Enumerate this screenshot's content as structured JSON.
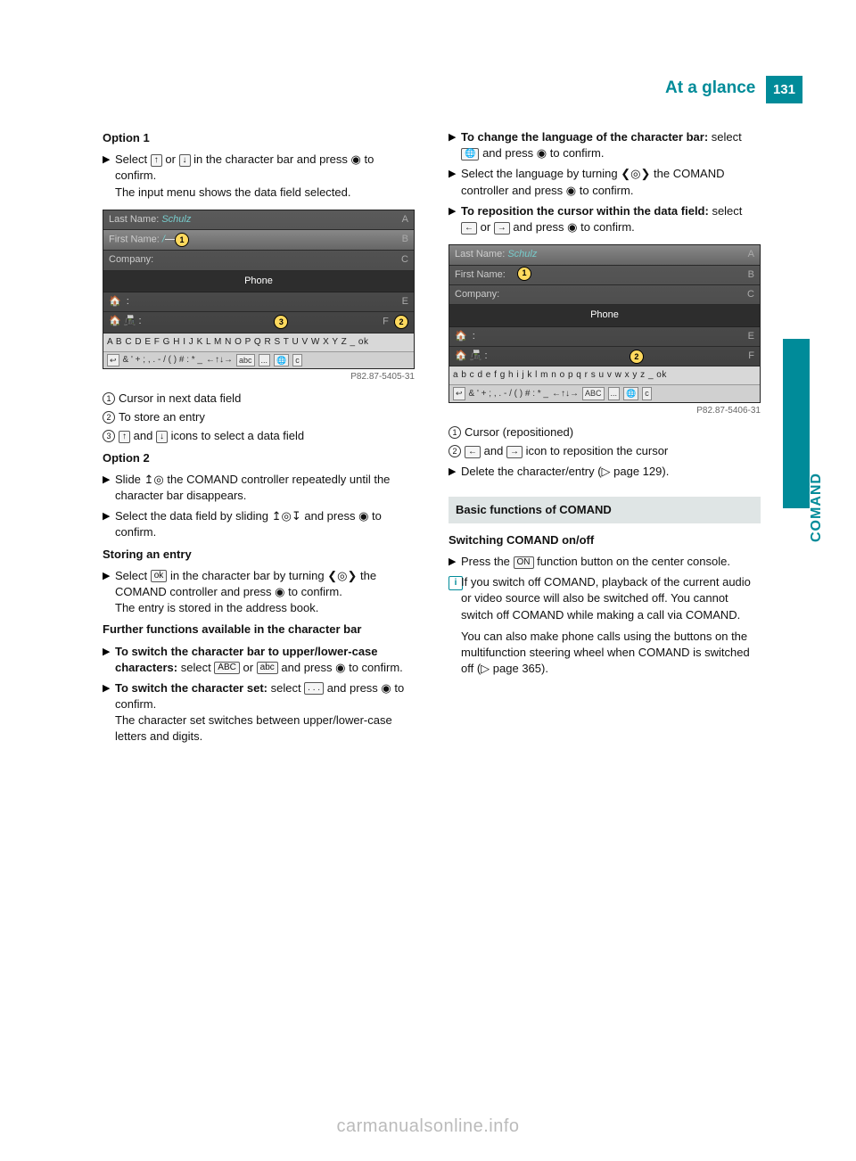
{
  "header": {
    "title": "At a glance",
    "page": "131"
  },
  "side": {
    "label": "COMAND"
  },
  "left": {
    "opt1_title": "Option 1",
    "opt1_step1a": "Select ",
    "opt1_step1b": " or ",
    "opt1_step1c": " in the character bar and press ",
    "opt1_step1d": " to confirm.",
    "opt1_step1_sub": "The input menu shows the data field selected.",
    "fig1_caption": "P82.87-5405-31",
    "fig1_lastname_label": "Last Name:",
    "fig1_lastname_val": "Schulz",
    "fig1_firstname_label": "First Name:",
    "fig1_firstname_val": "/",
    "fig1_company_label": "Company:",
    "fig1_phone": "Phone",
    "fig1_charbar": "A B C D E F G H I J K L M N O P Q R S T U V W X Y Z _ ok",
    "fig1_symrow": "& ' + ; , . - / ( ) # : * _",
    "legend1_1": "Cursor in next data field",
    "legend1_2": "To store an entry",
    "legend1_3a": " and ",
    "legend1_3b": " icons to select a data field",
    "opt2_title": "Option 2",
    "opt2_step1": "Slide ",
    "opt2_step1b": " the COMAND controller repeatedly until the character bar disappears.",
    "opt2_step2": "Select the data field by sliding ",
    "opt2_step2b": " and press ",
    "opt2_step2c": " to confirm.",
    "storing_title": "Storing an entry",
    "storing_step1a": "Select ",
    "storing_step1b": " in the character bar by turning ",
    "storing_step1c": " the COMAND controller and press ",
    "storing_step1d": " to confirm.",
    "storing_sub": "The entry is stored in the address book.",
    "further_title": "Further functions available in the character bar",
    "further_1a": "To switch the character bar to upper/lower-case characters: ",
    "further_1b": "select ",
    "further_1c": " or ",
    "further_1d": " and press ",
    "further_1e": " to confirm.",
    "further_2a": "To switch the character set: ",
    "further_2b": "select ",
    "further_2c": " and press ",
    "further_2d": " to confirm.",
    "further_2sub": "The character set switches between upper/lower-case letters and digits."
  },
  "right": {
    "lang_1a": "To change the language of the character bar: ",
    "lang_1b": "select ",
    "lang_1c": " and press ",
    "lang_1d": " to confirm.",
    "lang_2a": "Select the language by turning ",
    "lang_2b": " the COMAND controller and press ",
    "lang_2c": " to confirm.",
    "repos_1a": "To reposition the cursor within the data field: ",
    "repos_1b": "select ",
    "repos_1c": " or ",
    "repos_1d": " and press ",
    "repos_1e": " to confirm.",
    "fig2_caption": "P82.87-5406-31",
    "fig2_lastname_label": "Last Name:",
    "fig2_lastname_val": "Schulz",
    "fig2_firstname_label": "First Name:",
    "fig2_company_label": "Company:",
    "fig2_phone": "Phone",
    "fig2_charbar": "a b c d e f g h i j k l m n o p q r s  u v w x y z _ ok",
    "fig2_symrow": "& ' + ; , . - / ( ) # : * _",
    "legend2_1": "Cursor (repositioned)",
    "legend2_2a": " and ",
    "legend2_2b": " icon to reposition the cursor",
    "delete_a": "Delete the character/entry (",
    "delete_b": " page 129).",
    "sec_heading": "Basic functions of COMAND",
    "switch_title": "Switching COMAND on/off",
    "switch_step_a": "Press the ",
    "switch_step_b": " function button on the center console.",
    "info1": "If you switch off COMAND, playback of the current audio or video source will also be switched off. You cannot switch off COMAND while making a call via COMAND.",
    "info2": "You can also make phone calls using the buttons on the multifunction steering wheel when COMAND is switched off (",
    "info2b": " page 365)."
  },
  "icons": {
    "up": "↑",
    "down": "↓",
    "left": "←",
    "right": "→",
    "press": "◉",
    "ok": "ok",
    "ABC": "ABC",
    "abc": "abc",
    "dots": ". . .",
    "globe": "🌐",
    "ON": "ON",
    "info": "i",
    "tri": "▷",
    "slide_up": "↥◎",
    "slide_vert": "↥◎↧",
    "turn": "❮◎❯"
  },
  "footer": "carmanualsonline.info"
}
